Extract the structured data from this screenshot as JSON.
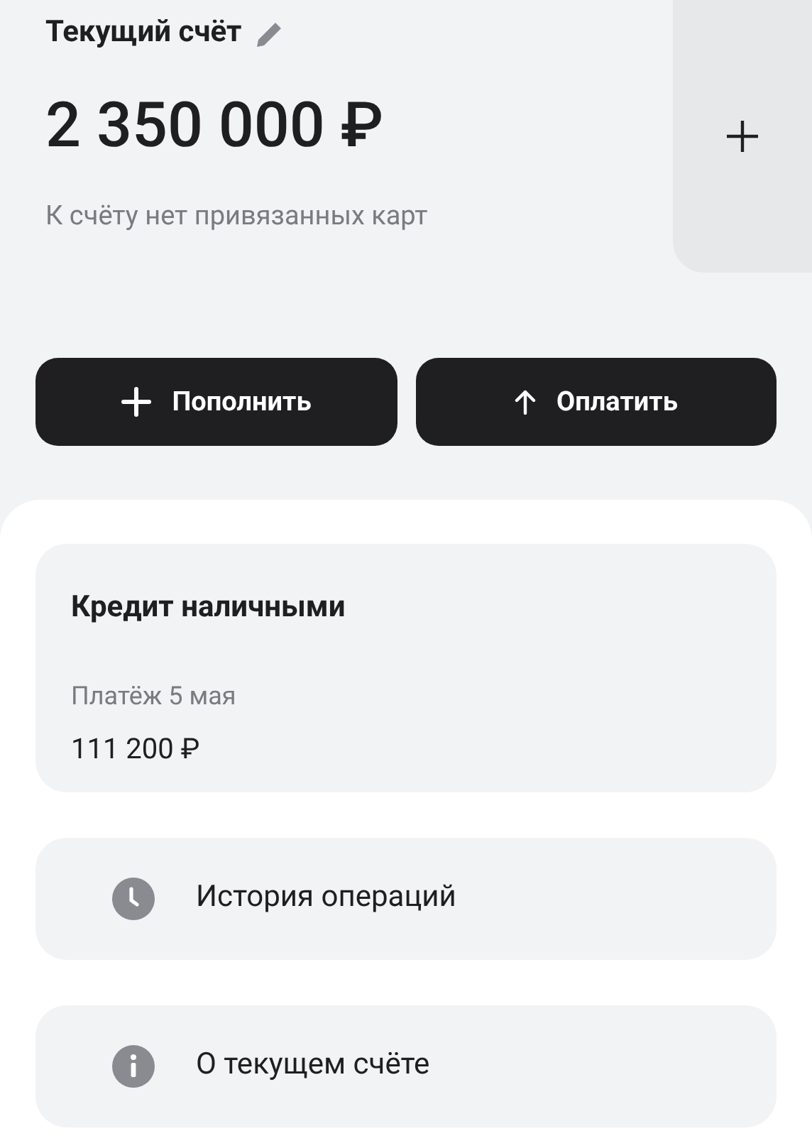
{
  "account": {
    "title": "Текущий счёт",
    "balance": "2 350 000 ₽",
    "cards_note": "К счёту нет привязанных карт"
  },
  "actions": [
    {
      "kind": "plus",
      "label": "Пополнить"
    },
    {
      "kind": "arrow-up",
      "label": "Оплатить"
    }
  ],
  "loan": {
    "title": "Кредит наличными",
    "payment_label": "Платёж 5 мая",
    "payment_amount": "111 200 ₽"
  },
  "menu": [
    {
      "kind": "clock",
      "label": "История операций"
    },
    {
      "kind": "info",
      "label": "О текущем счёте"
    }
  ]
}
